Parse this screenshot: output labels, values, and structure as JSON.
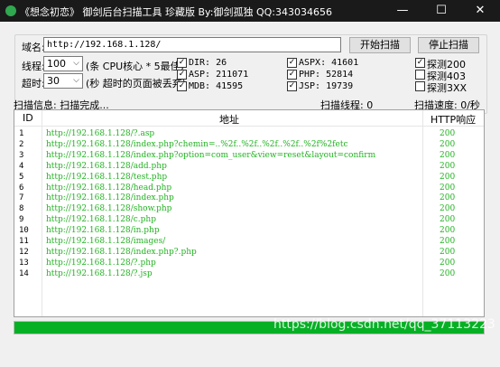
{
  "window": {
    "title": "《想念初恋》 御剑后台扫描工具 珍藏版 By:御剑孤独 QQ:343034656",
    "minimize": "—",
    "maximize": "☐",
    "close": "✕"
  },
  "form": {
    "domain_label": "域名:",
    "domain_value": "http://192.168.1.128/",
    "threads_label": "线程:",
    "threads_value": "100",
    "threads_hint": "(条 CPU核心 * 5最佳)",
    "timeout_label": "超时:",
    "timeout_value": "30",
    "timeout_hint": "(秒 超时的页面被丢弃)",
    "start_button": "开始扫描",
    "stop_button": "停止扫描"
  },
  "dictionaries": [
    {
      "label": "DIR: 26",
      "checked": true
    },
    {
      "label": "ASP: 211071",
      "checked": true
    },
    {
      "label": "MDB: 41595",
      "checked": true
    },
    {
      "label": "ASPX: 41601",
      "checked": true
    },
    {
      "label": "PHP: 52814",
      "checked": true
    },
    {
      "label": "JSP: 19739",
      "checked": true
    }
  ],
  "probes": [
    {
      "label": "探测200",
      "checked": true
    },
    {
      "label": "探测403",
      "checked": false
    },
    {
      "label": "探测3XX",
      "checked": false
    }
  ],
  "status": {
    "scan_info": "扫描信息: 扫描完成...",
    "scan_threads": "扫描线程: 0",
    "scan_speed": "扫描速度: 0/秒"
  },
  "table": {
    "headers": [
      "ID",
      "地址",
      "HTTP响应"
    ],
    "rows": [
      {
        "id": "1",
        "url": "http://192.168.1.128/?.asp",
        "code": "200"
      },
      {
        "id": "2",
        "url": "http://192.168.1.128/index.php?chemin=..%2f..%2f..%2f..%2f..%2f%2fetc",
        "code": "200"
      },
      {
        "id": "3",
        "url": "http://192.168.1.128/index.php?option=com_user&view=reset&layout=confirm",
        "code": "200"
      },
      {
        "id": "4",
        "url": "http://192.168.1.128/add.php",
        "code": "200"
      },
      {
        "id": "5",
        "url": "http://192.168.1.128/test.php",
        "code": "200"
      },
      {
        "id": "6",
        "url": "http://192.168.1.128/head.php",
        "code": "200"
      },
      {
        "id": "7",
        "url": "http://192.168.1.128/index.php",
        "code": "200"
      },
      {
        "id": "8",
        "url": "http://192.168.1.128/show.php",
        "code": "200"
      },
      {
        "id": "9",
        "url": "http://192.168.1.128/c.php",
        "code": "200"
      },
      {
        "id": "10",
        "url": "http://192.168.1.128/in.php",
        "code": "200"
      },
      {
        "id": "11",
        "url": "http://192.168.1.128/images/",
        "code": "200"
      },
      {
        "id": "12",
        "url": "http://192.168.1.128/index.php?.php",
        "code": "200"
      },
      {
        "id": "13",
        "url": "http://192.168.1.128/?.php",
        "code": "200"
      },
      {
        "id": "14",
        "url": "http://192.168.1.128/?.jsp",
        "code": "200"
      }
    ]
  },
  "progress": {
    "percent": 100
  },
  "watermark": "https://blog.csdn.net/qq_37113223",
  "colors": {
    "accent_green": "#22b322",
    "progress_green": "#06b025"
  }
}
